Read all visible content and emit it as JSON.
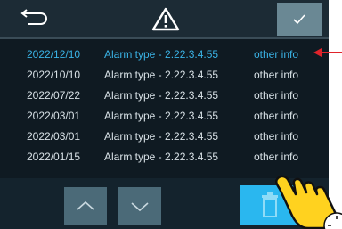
{
  "header": {
    "icons": [
      "back-arrow-icon",
      "warning-triangle-icon",
      "checkmark-icon"
    ]
  },
  "colors": {
    "background": "#0f1a22",
    "header": "#1c2b35",
    "selected_text": "#3ab3e6",
    "row_text": "#d9e2e7",
    "nav_button": "#4b6a78",
    "delete_button": "#2ab7ef",
    "callout": "#e0242b"
  },
  "alarms": [
    {
      "date": "2022/12/10",
      "type": "Alarm type - 2.22.3.4.55",
      "info": "other info",
      "selected": true
    },
    {
      "date": "2022/10/10",
      "type": "Alarm type - 2.22.3.4.55",
      "info": "other info",
      "selected": false
    },
    {
      "date": "2022/07/22",
      "type": "Alarm type - 2.22.3.4.55",
      "info": "other info",
      "selected": false
    },
    {
      "date": "2022/03/01",
      "type": "Alarm type - 2.22.3.4.55",
      "info": "other info",
      "selected": false
    },
    {
      "date": "2022/03/01",
      "type": "Alarm type - 2.22.3.4.55",
      "info": "other info",
      "selected": false
    },
    {
      "date": "2022/01/15",
      "type": "Alarm type - 2.22.3.4.55",
      "info": "other info",
      "selected": false
    }
  ],
  "footer": {
    "icons": [
      "chevron-up-icon",
      "chevron-down-icon",
      "trash-icon"
    ]
  },
  "annotations": {
    "icons": [
      "red-callout-arrow-icon",
      "pointing-hand-icon"
    ]
  }
}
